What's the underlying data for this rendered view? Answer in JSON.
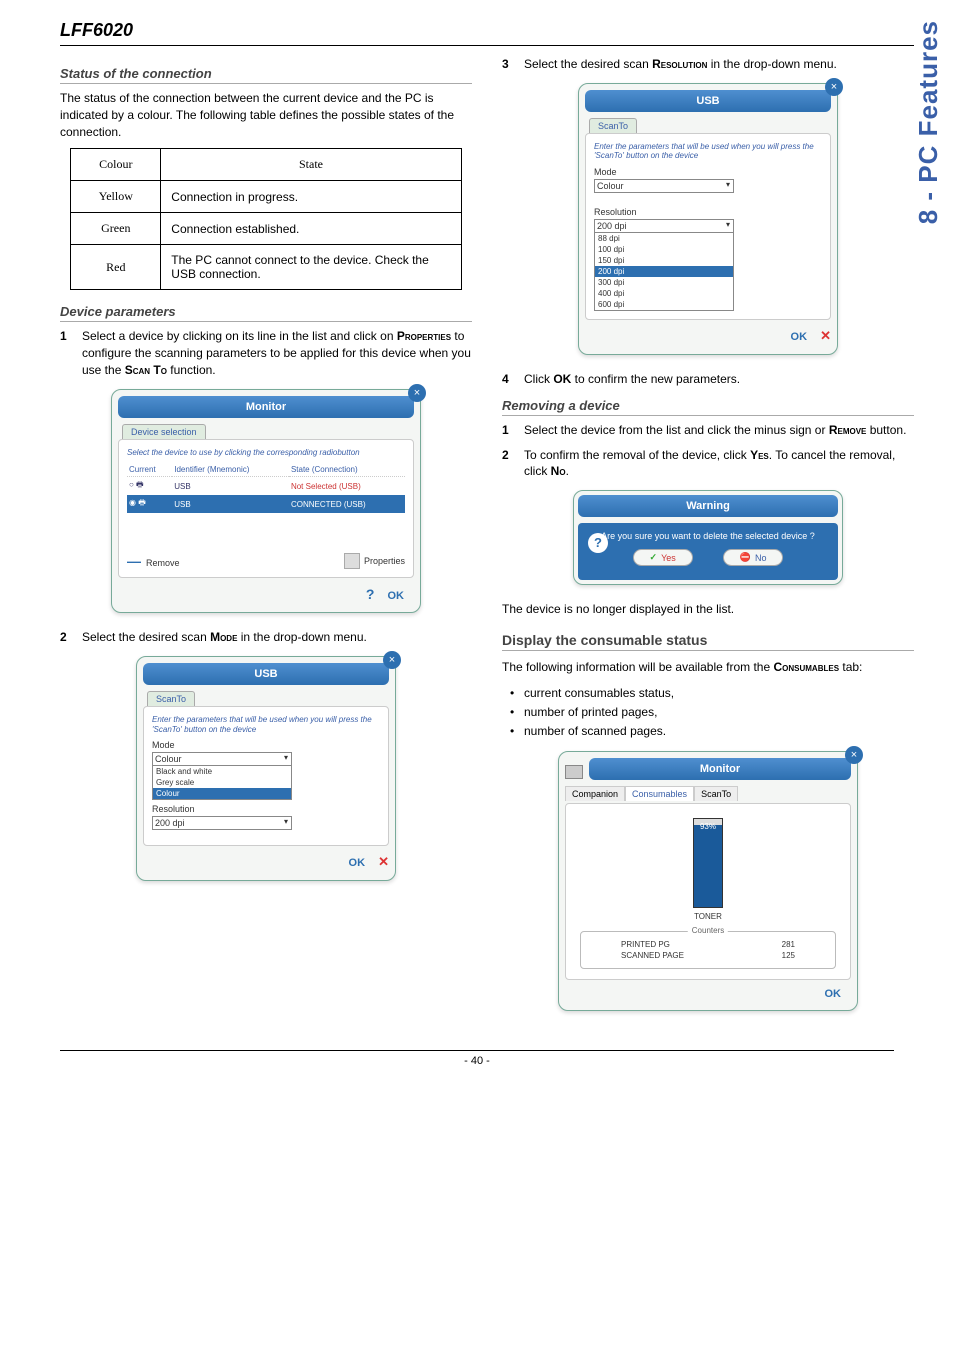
{
  "product": "LFF6020",
  "sideTab": "8 - PC Features",
  "pageNumber": "- 40 -",
  "left": {
    "sec1": {
      "title": "Status of the connection",
      "intro": "The status of the connection between the current device and the PC is indicated by a colour. The following table defines the possible states of the connection.",
      "table": {
        "h1": "Colour",
        "h2": "State",
        "rows": [
          {
            "c": "Yellow",
            "s": "Connection in progress."
          },
          {
            "c": "Green",
            "s": "Connection established."
          },
          {
            "c": "Red",
            "s": "The PC cannot connect to the device. Check the USB connection."
          }
        ]
      }
    },
    "sec2": {
      "title": "Device parameters",
      "step1": {
        "num": "1",
        "t0": "Select a device by clicking on its line in the list and click on ",
        "t1": "Properties",
        "t2": " to configure the scanning parameters to be applied for this device when you use the ",
        "t3": "Scan To",
        "t4": " function."
      },
      "monitor": {
        "title": "Monitor",
        "tab": "Device selection",
        "hint": "Select the device to use by clicking the corresponding radiobutton",
        "h1": "Current",
        "h2": "Identifier (Mnemonic)",
        "h3": "State (Connection)",
        "r1id": "USB",
        "r1state": "Not Selected (USB)",
        "r2id": "USB",
        "r2state": "CONNECTED (USB)",
        "remove": "Remove",
        "properties": "Properties",
        "ok": "OK"
      },
      "step2": {
        "num": "2",
        "t0": "Select the desired scan ",
        "t1": "Mode",
        "t2": " in the drop-down menu."
      },
      "usb1": {
        "title": "USB",
        "tab": "ScanTo",
        "hint": "Enter the parameters that will be used when you will press the 'ScanTo' button on the device",
        "modeLabel": "Mode",
        "modeSel": "Colour",
        "modeOpts": [
          "Black and white",
          "Grey scale",
          "Colour"
        ],
        "resLabel": "Resolution",
        "resSel": "200 dpi",
        "ok": "OK"
      }
    }
  },
  "right": {
    "step3": {
      "num": "3",
      "t0": "Select the desired scan ",
      "t1": "Resolution",
      "t2": " in the drop-down menu."
    },
    "usb2": {
      "title": "USB",
      "tab": "ScanTo",
      "hint": "Enter the parameters that will be used when you will press the 'ScanTo' button on the device",
      "modeLabel": "Mode",
      "modeSel": "Colour",
      "resLabel": "Resolution",
      "resSel": "200 dpi",
      "resOpts": [
        "88 dpi",
        "100 dpi",
        "150 dpi",
        "200 dpi",
        "300 dpi",
        "400 dpi",
        "600 dpi"
      ],
      "ok": "OK"
    },
    "step4": {
      "num": "4",
      "t0": "Click ",
      "t1": "OK",
      "t2": " to confirm the new parameters."
    },
    "removing": {
      "title": "Removing a device",
      "s1": {
        "num": "1",
        "t0": "Select the device from the list and click the minus sign or ",
        "t1": "Remove",
        "t2": " button."
      },
      "s2": {
        "num": "2",
        "t0": "To confirm the removal of the device, click ",
        "t1": "Yes",
        "t2": ". To cancel the removal, click ",
        "t3": "No",
        "t4": "."
      },
      "warn": {
        "title": "Warning",
        "msg": "Are you sure you want to delete the selected device ?",
        "yes": "Yes",
        "no": "No"
      },
      "after": "The device is no longer displayed in the list."
    },
    "consumable": {
      "title": "Display the consumable status",
      "intro0": "The following information will be available from the ",
      "intro1": "Consumables",
      "intro2": " tab:",
      "bullets": [
        "current consumables status,",
        "number of printed pages,",
        "number of scanned pages."
      ],
      "monitor": {
        "title": "Monitor",
        "tabs": [
          "Companion",
          "Consumables",
          "ScanTo"
        ],
        "tonerPct": "93%",
        "tonerLabel": "TONER",
        "countersLabel": "Counters",
        "printed": "PRINTED PG",
        "printedVal": "281",
        "scanned": "SCANNED PAGE",
        "scannedVal": "125",
        "ok": "OK"
      }
    }
  }
}
